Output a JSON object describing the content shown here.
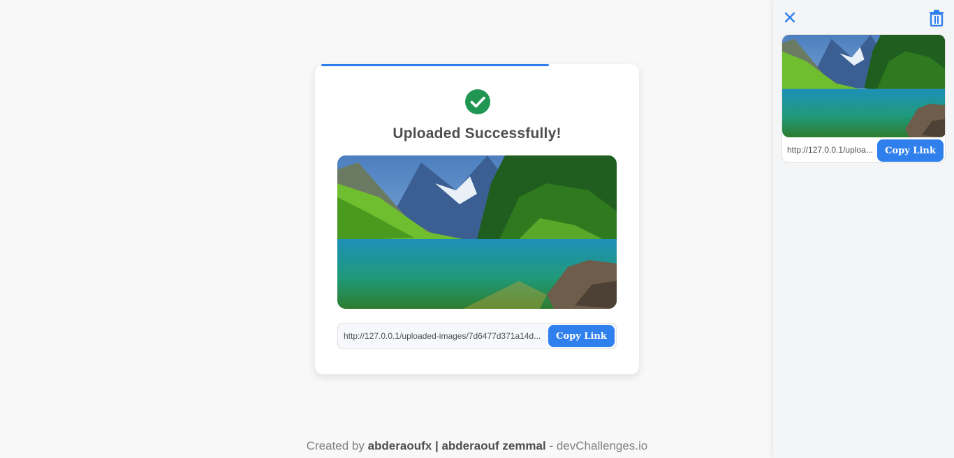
{
  "upload": {
    "title": "Uploaded Successfully!",
    "progress": 0.73,
    "link": "http://127.0.0.1/uploaded-images/7d6477d371a14d...",
    "copy_label": "Copy Link",
    "image_alt": "mountain-lake-forest-landscape"
  },
  "footer": {
    "prefix": "Created by ",
    "author": "abderaoufx | abderaouf zemmal",
    "separator": " - ",
    "site": "devChallenges.io"
  },
  "side_panel": {
    "close_icon": "close-icon",
    "delete_icon": "trash-icon",
    "items": [
      {
        "link": "http://127.0.0.1/uploa...",
        "copy_label": "Copy Link"
      }
    ]
  },
  "colors": {
    "accent": "#2f80ed",
    "success": "#219653",
    "background": "#f8f8f8",
    "title_text": "#4f4f4f"
  }
}
